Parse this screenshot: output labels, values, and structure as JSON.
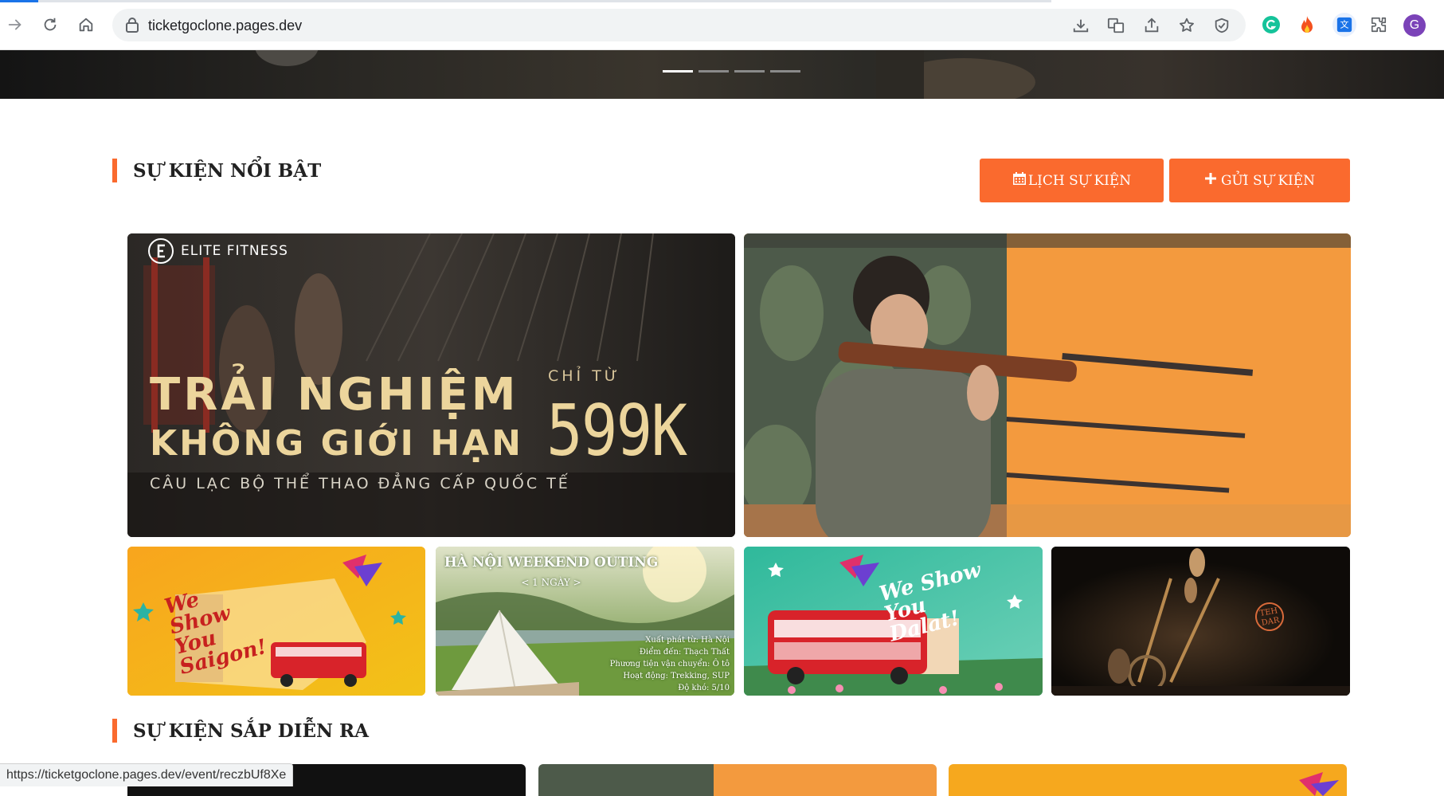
{
  "browser": {
    "url": "ticketgoclone.pages.dev",
    "status_url": "https://ticketgoclone.pages.dev/event/reczbUf8Xe",
    "profile_initial": "G",
    "accent": "#1a73e8"
  },
  "hero": {
    "slide_count": 4,
    "active_slide": 1
  },
  "featured": {
    "title": "SỰ KIỆN NỔI BẬT",
    "calendar_button": "LỊCH SỰ KIỆN",
    "submit_button": "GỬI SỰ KIỆN",
    "accent": "#fa6a2e"
  },
  "cards": {
    "fitness": {
      "brand": "ELITE FITNESS",
      "headline1": "TRẢI NGHIỆM",
      "headline2": "KHÔNG GIỚI HẠN",
      "from_label": "CHỈ TỪ",
      "price": "599K",
      "tagline": "CÂU LẠC BỘ THỂ THAO ĐẲNG CẤP QUỐC TẾ"
    },
    "saigon": {
      "script": "We Show You Saigon!"
    },
    "outing": {
      "title": "HÀ NỘI WEEKEND OUTING",
      "subtitle": "< 1 NGÀY >",
      "lines": [
        "Xuất phát từ: Hà Nội",
        "Điểm đến: Thạch Thất",
        "Phương tiện vận chuyển: Ô tô",
        "Hoạt động: Trekking, SUP",
        "Độ khó: 5/10"
      ]
    },
    "dalat": {
      "script": "We Show You Dalat!"
    },
    "show": {
      "logo": "TEH DAR"
    }
  },
  "upcoming": {
    "title": "SỰ KIỆN SẮP DIỄN RA"
  }
}
